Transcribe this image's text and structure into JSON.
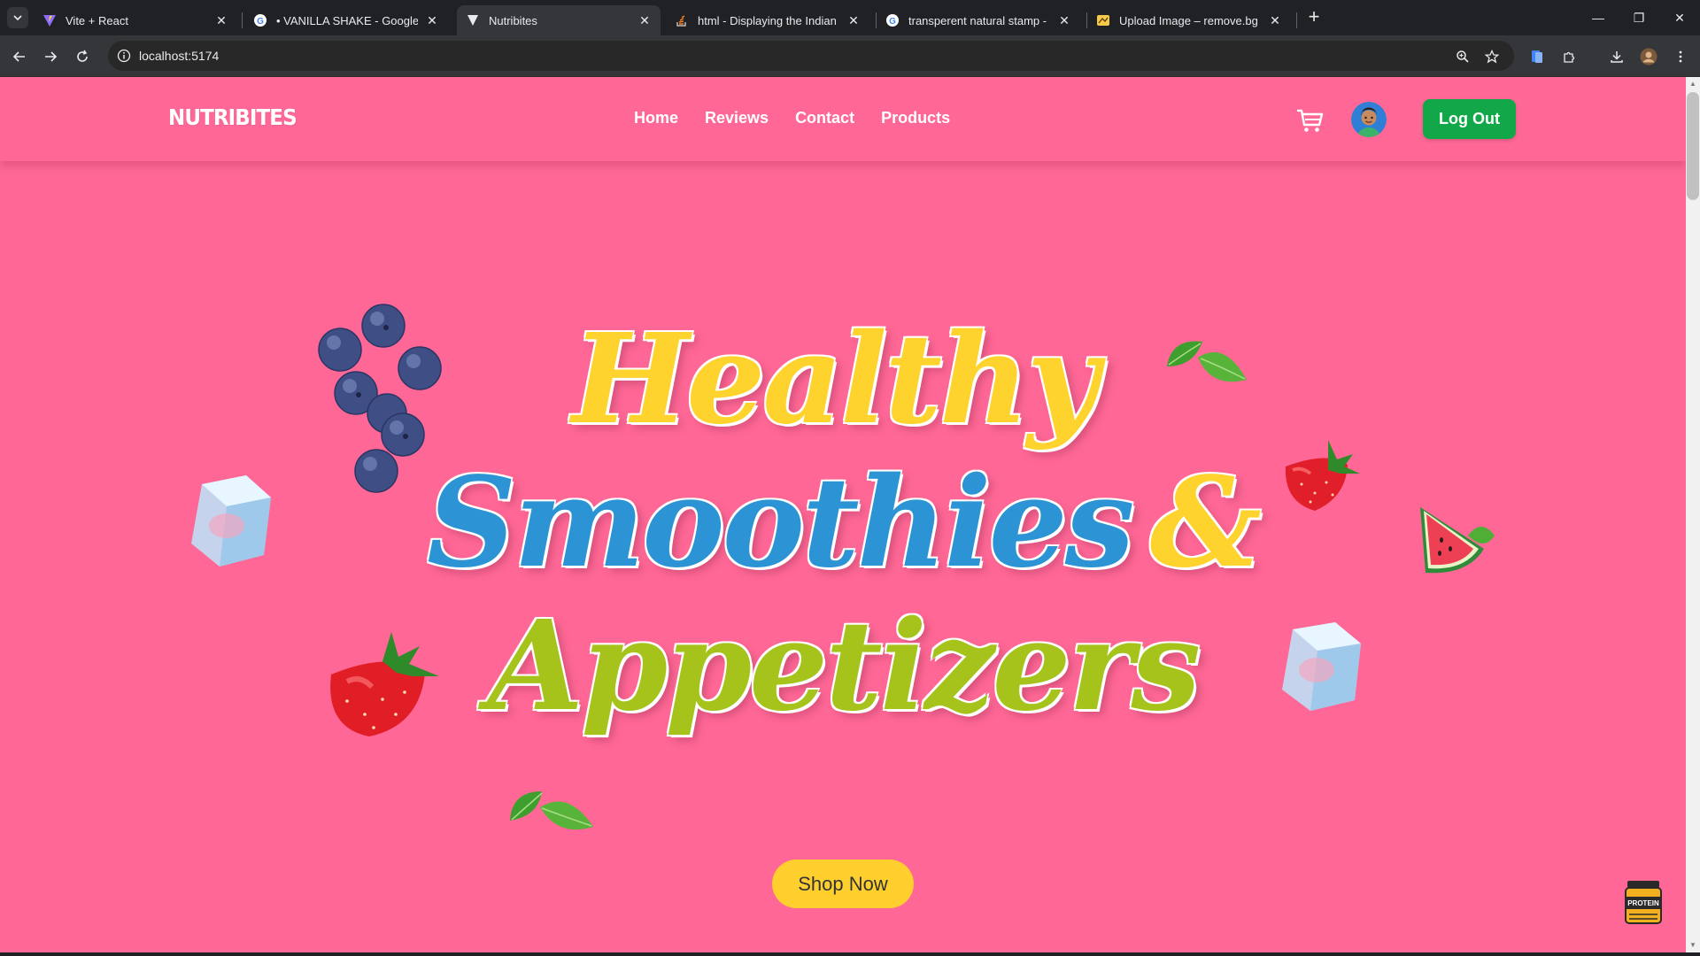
{
  "browser": {
    "tabs": [
      {
        "title": "Vite + React",
        "icon": "vite-logo-icon"
      },
      {
        "title": "• VANILLA SHAKE - Google Sea",
        "icon": "google-g-icon"
      },
      {
        "title": "Nutribites",
        "icon": "nutribites-favicon-icon"
      },
      {
        "title": "html - Displaying the Indian cur",
        "icon": "stackoverflow-icon"
      },
      {
        "title": "transperent natural stamp - Goo",
        "icon": "google-g-icon"
      },
      {
        "title": "Upload Image – remove.bg",
        "icon": "removebg-icon"
      }
    ],
    "active_tab": 2,
    "close_glyph": "✕",
    "new_tab_glyph": "+",
    "url": "localhost:5174",
    "window_controls": {
      "minimize": "—",
      "restore": "❐",
      "close": "✕"
    }
  },
  "page": {
    "logo": "NUTRIBITES",
    "nav": [
      {
        "label": "Home"
      },
      {
        "label": "Reviews"
      },
      {
        "label": "Contact"
      },
      {
        "label": "Products"
      }
    ],
    "logout_label": "Log Out",
    "hero": {
      "line1": "Healthy",
      "line2": "Smoothies",
      "amp": "&",
      "line3": "Appetizers"
    },
    "shop_now_label": "Shop Now",
    "widget_label": "PROTEIN"
  },
  "colors": {
    "page_bg": "#ff6896",
    "healthy": "#ffd32e",
    "smoothies": "#2c93d4",
    "appetizers": "#a6c31c",
    "logout_bg": "#12a84a",
    "shop_now_bg": "#ffcf2e"
  }
}
